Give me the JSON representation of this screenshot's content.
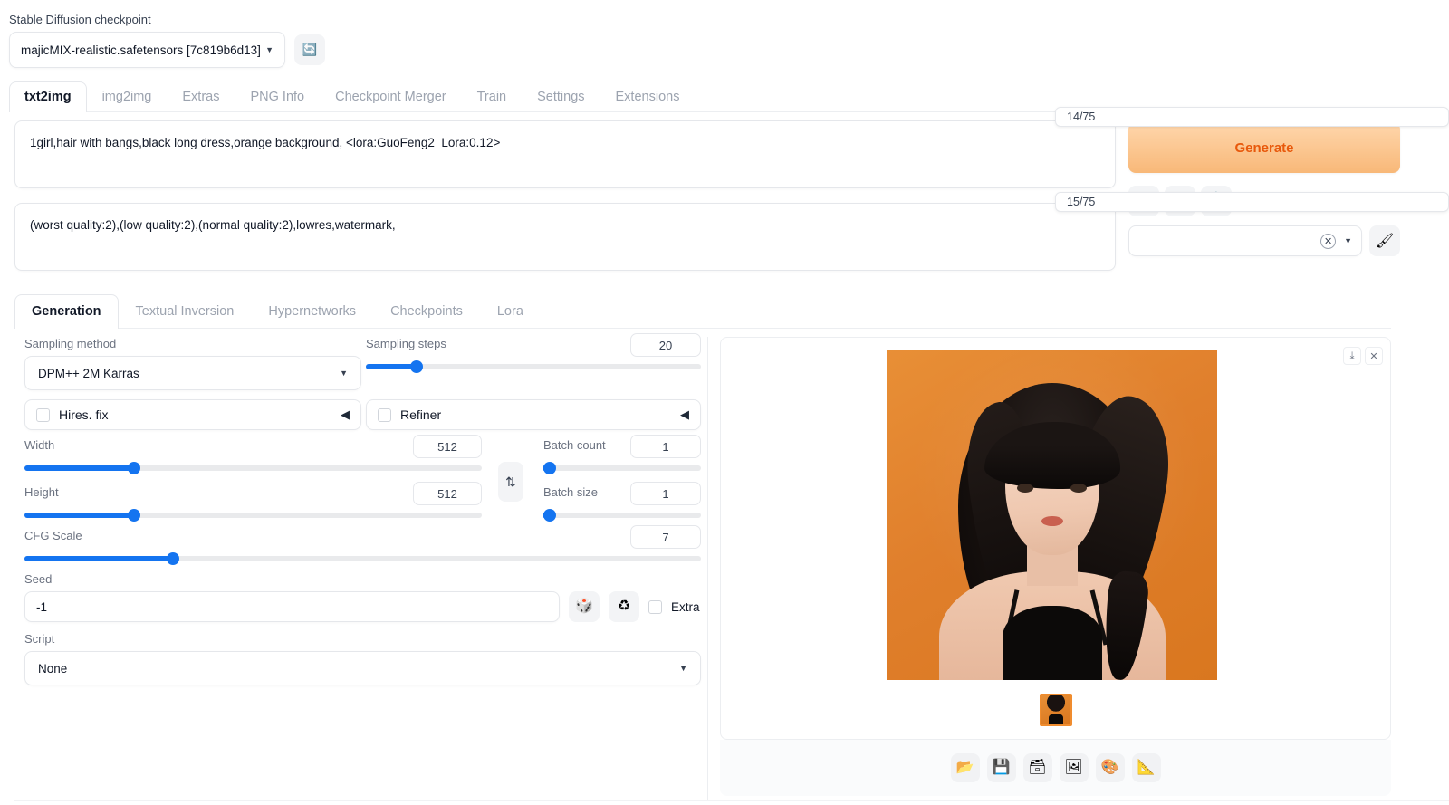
{
  "checkpoint": {
    "label": "Stable Diffusion checkpoint",
    "value": "majicMIX-realistic.safetensors [7c819b6d13]",
    "caret": "▼",
    "refresh_icon": "🔄"
  },
  "top_tabs": [
    {
      "label": "txt2img",
      "active": true
    },
    {
      "label": "img2img",
      "active": false
    },
    {
      "label": "Extras",
      "active": false
    },
    {
      "label": "PNG Info",
      "active": false
    },
    {
      "label": "Checkpoint Merger",
      "active": false
    },
    {
      "label": "Train",
      "active": false
    },
    {
      "label": "Settings",
      "active": false
    },
    {
      "label": "Extensions",
      "active": false
    }
  ],
  "prompts": {
    "positive": "1girl,hair with bangs,black long dress,orange background, <lora:GuoFeng2_Lora:0.12>",
    "positive_tokens": "14/75",
    "negative": "(worst quality:2),(low quality:2),(normal quality:2),lowres,watermark,",
    "negative_tokens": "15/75"
  },
  "actions": {
    "generate_label": "Generate",
    "arrow_icon": "↙",
    "trash_icon": "🗑",
    "clipboard_icon": "📋",
    "styles_value": "",
    "styles_clear_icon": "✕",
    "styles_caret": "▼",
    "brush_icon": "🖌"
  },
  "sub_tabs": [
    {
      "label": "Generation",
      "active": true
    },
    {
      "label": "Textual Inversion",
      "active": false
    },
    {
      "label": "Hypernetworks",
      "active": false
    },
    {
      "label": "Checkpoints",
      "active": false
    },
    {
      "label": "Lora",
      "active": false
    }
  ],
  "settings": {
    "sampling_method": {
      "label": "Sampling method",
      "value": "DPM++ 2M Karras",
      "caret": "▼"
    },
    "sampling_steps": {
      "label": "Sampling steps",
      "value": "20",
      "fill_percent": 15
    },
    "hires_fix": {
      "label": "Hires. fix",
      "arrow": "◀",
      "checked": false
    },
    "refiner": {
      "label": "Refiner",
      "arrow": "◀",
      "checked": false
    },
    "width": {
      "label": "Width",
      "value": "512",
      "fill_percent": 24
    },
    "height": {
      "label": "Height",
      "value": "512",
      "fill_percent": 24
    },
    "swap_icon": "⇅",
    "batch_count": {
      "label": "Batch count",
      "value": "1",
      "fill_percent": 1
    },
    "batch_size": {
      "label": "Batch size",
      "value": "1",
      "fill_percent": 1
    },
    "cfg_scale": {
      "label": "CFG Scale",
      "value": "7",
      "fill_percent": 22
    },
    "seed": {
      "label": "Seed",
      "value": "-1",
      "dice_icon": "🎲",
      "recycle_icon": "♻",
      "extra_label": "Extra",
      "extra_checked": false
    },
    "script": {
      "label": "Script",
      "value": "None",
      "caret": "▼"
    }
  },
  "result": {
    "download_icon": "⤓",
    "close_icon": "✕",
    "toolbar": [
      {
        "name": "open-folder",
        "icon": "📂"
      },
      {
        "name": "save",
        "icon": "💾"
      },
      {
        "name": "save-zip",
        "icon": "🗃"
      },
      {
        "name": "send-to-img2img",
        "icon": "🖼"
      },
      {
        "name": "send-to-inpaint",
        "icon": "🎨"
      },
      {
        "name": "send-to-extras",
        "icon": "📐"
      }
    ]
  },
  "colors": {
    "accent_blue": "#1474f0",
    "generate_orange": "#e8590c",
    "image_background": "#e07f2c"
  }
}
